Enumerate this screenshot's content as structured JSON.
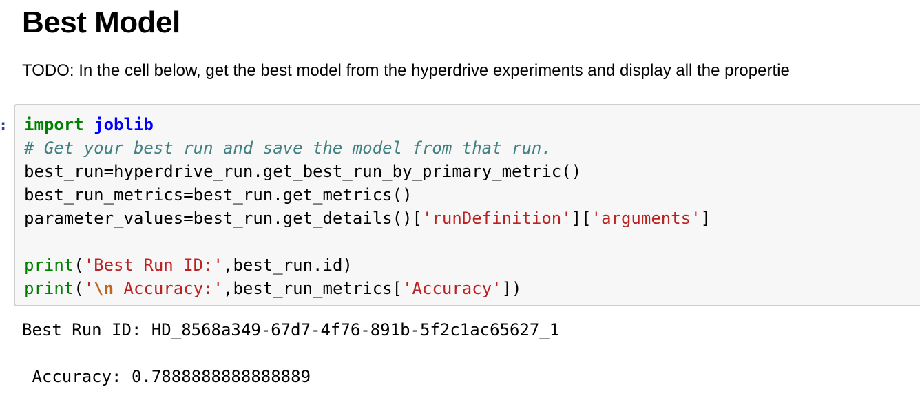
{
  "markdown": {
    "heading": "Best Model",
    "todo_text": "TODO: In the cell below, get the best model from the hyperdrive experiments and display all the propertie"
  },
  "cell": {
    "prompt": ":",
    "code": {
      "l1_kw": "import",
      "l1_mod": "joblib",
      "l2_comment": "# Get your best run and save the model from that run.",
      "l3": "best_run=hyperdrive_run.get_best_run_by_primary_metric()",
      "l4": "best_run_metrics=best_run.get_metrics()",
      "l5_a": "parameter_values=best_run.get_details()[",
      "l5_s1": "'runDefinition'",
      "l5_b": "][",
      "l5_s2": "'arguments'",
      "l5_c": "]",
      "l7_fn": "print",
      "l7_a": "(",
      "l7_s": "'Best Run ID:'",
      "l7_b": ",best_run.id)",
      "l8_fn": "print",
      "l8_a": "(",
      "l8_s1": "'",
      "l8_esc": "\\n",
      "l8_s2": " Accuracy:'",
      "l8_b": ",best_run_metrics[",
      "l8_s3": "'Accuracy'",
      "l8_c": "])"
    }
  },
  "output": {
    "line1": "Best Run ID: HD_8568a349-67d7-4f76-891b-5f2c1ac65627_1",
    "line2": "",
    "line3": " Accuracy: 0.7888888888888889"
  }
}
